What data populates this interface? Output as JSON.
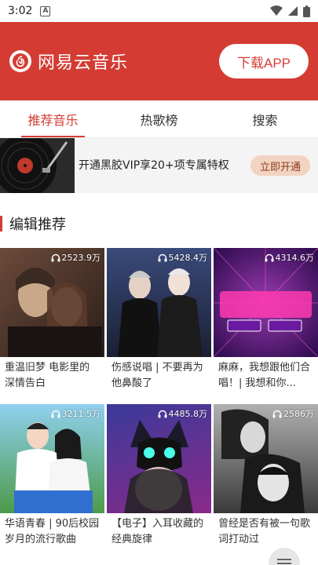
{
  "status": {
    "time": "3:02",
    "notif_letter": "A"
  },
  "header": {
    "app_name": "网易云音乐",
    "download_label": "下载APP"
  },
  "tabs": [
    {
      "label": "推荐音乐",
      "active": true
    },
    {
      "label": "热歌榜",
      "active": false
    },
    {
      "label": "搜索",
      "active": false
    }
  ],
  "vip_banner": {
    "text": "开通黑胶VIP享20+项专属特权",
    "button": "立即开通"
  },
  "section": {
    "title": "编辑推荐"
  },
  "playlists": [
    {
      "plays": "2523.9万",
      "title": "重温旧梦 电影里的深情告白",
      "bg1": "#6b4a3a",
      "bg2": "#2c1f1a"
    },
    {
      "plays": "5428.4万",
      "title": "伤感说唱 | 不要再为他鼻酸了",
      "bg1": "#3a4a7a",
      "bg2": "#1a1f33"
    },
    {
      "plays": "4314.6万",
      "title": "麻麻，我想跟他们合唱！| 我想和你...",
      "bg1": "#7a2a9a",
      "bg2": "#2a0a4a"
    },
    {
      "plays": "3211.5万",
      "title": "华语青春 | 90后校园岁月的流行歌曲",
      "bg1": "#5aa7d8",
      "bg2": "#2f6fa0"
    },
    {
      "plays": "4485.8万",
      "title": "【电子】入耳收藏的经典旋律",
      "bg1": "#3a3a9a",
      "bg2": "#8a2a8a"
    },
    {
      "plays": "2586万",
      "title": "曾经是否有被一句歌词打动过",
      "bg1": "#9a9a9a",
      "bg2": "#3a3a3a"
    }
  ],
  "colors": {
    "brand_red": "#d43c33",
    "vip_button": "#f3d3c1"
  }
}
